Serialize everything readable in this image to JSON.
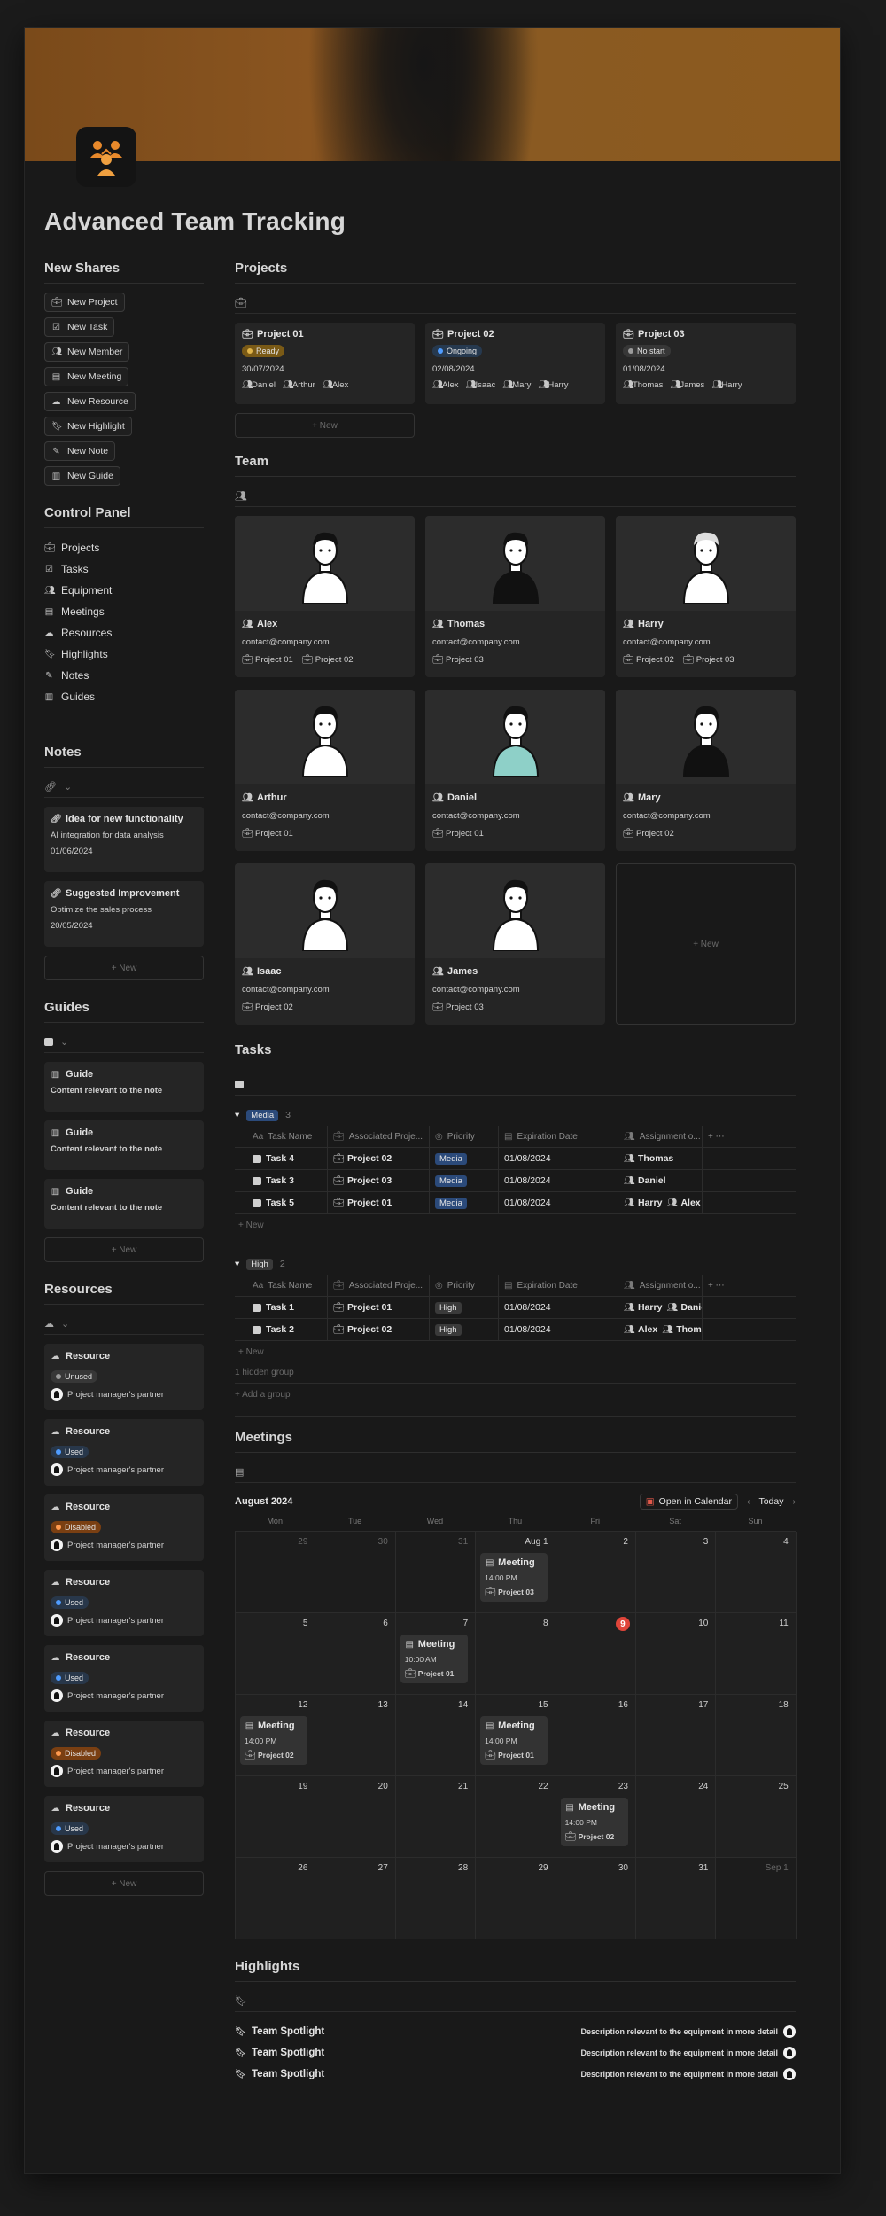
{
  "title": "Advanced Team Tracking",
  "new_shares": {
    "heading": "New Shares",
    "buttons": [
      {
        "label": "New Project",
        "icon": "briefcase-icon"
      },
      {
        "label": "New Task",
        "icon": "checkbox-icon"
      },
      {
        "label": "New Member",
        "icon": "people-icon"
      },
      {
        "label": "New Meeting",
        "icon": "calendar-icon"
      },
      {
        "label": "New Resource",
        "icon": "cloud-icon"
      },
      {
        "label": "New Highlight",
        "icon": "bookmark-icon"
      },
      {
        "label": "New Note",
        "icon": "note-icon"
      },
      {
        "label": "New Guide",
        "icon": "book-icon"
      }
    ]
  },
  "control_panel": {
    "heading": "Control Panel",
    "items": [
      "Projects",
      "Tasks",
      "Equipment",
      "Meetings",
      "Resources",
      "Highlights",
      "Notes",
      "Guides"
    ]
  },
  "notes": {
    "heading": "Notes",
    "cards": [
      {
        "title": "Idea for new functionality",
        "desc": "AI integration for data analysis",
        "date": "01/06/2024"
      },
      {
        "title": "Suggested Improvement",
        "desc": "Optimize the sales process",
        "date": "20/05/2024"
      }
    ],
    "new_label": "+ New"
  },
  "guides": {
    "heading": "Guides",
    "cards": [
      {
        "title": "Guide",
        "desc": "Content relevant to the note"
      },
      {
        "title": "Guide",
        "desc": "Content relevant to the note"
      },
      {
        "title": "Guide",
        "desc": "Content relevant to the note"
      }
    ],
    "new_label": "+ New"
  },
  "resources": {
    "heading": "Resources",
    "cards": [
      {
        "title": "Resource",
        "status": "Unused",
        "status_color": "#9b9b9b",
        "pill_bg": "#373737",
        "owner": "Project manager's partner"
      },
      {
        "title": "Resource",
        "status": "Used",
        "status_color": "#4f9cff",
        "pill_bg": "#28374a",
        "owner": "Project manager's partner"
      },
      {
        "title": "Resource",
        "status": "Disabled",
        "status_color": "#ff9a4f",
        "pill_bg": "#7a3f12",
        "owner": "Project manager's partner"
      },
      {
        "title": "Resource",
        "status": "Used",
        "status_color": "#4f9cff",
        "pill_bg": "#28374a",
        "owner": "Project manager's partner"
      },
      {
        "title": "Resource",
        "status": "Used",
        "status_color": "#4f9cff",
        "pill_bg": "#28374a",
        "owner": "Project manager's partner"
      },
      {
        "title": "Resource",
        "status": "Disabled",
        "status_color": "#ff9a4f",
        "pill_bg": "#7a3f12",
        "owner": "Project manager's partner"
      },
      {
        "title": "Resource",
        "status": "Used",
        "status_color": "#4f9cff",
        "pill_bg": "#28374a",
        "owner": "Project manager's partner"
      }
    ],
    "new_label": "+ New"
  },
  "projects": {
    "heading": "Projects",
    "cards": [
      {
        "title": "Project 01",
        "status": "Ready",
        "status_dot": "#e0b44a",
        "pill_bg": "#7a5a16",
        "date": "30/07/2024",
        "people": [
          "Daniel",
          "Arthur",
          "Alex"
        ]
      },
      {
        "title": "Project 02",
        "status": "Ongoing",
        "status_dot": "#4f9cff",
        "pill_bg": "#26394f",
        "date": "02/08/2024",
        "people": [
          "Alex",
          "Isaac",
          "Mary",
          "Harry"
        ]
      },
      {
        "title": "Project 03",
        "status": "No start",
        "status_dot": "#9b9b9b",
        "pill_bg": "#373737",
        "date": "01/08/2024",
        "people": [
          "Thomas",
          "James",
          "Harry"
        ]
      }
    ],
    "new_label": "+ New"
  },
  "team": {
    "heading": "Team",
    "members": [
      {
        "name": "Alex",
        "email": "contact@company.com",
        "projects": [
          "Project 01",
          "Project 02"
        ]
      },
      {
        "name": "Thomas",
        "email": "contact@company.com",
        "projects": [
          "Project 03"
        ]
      },
      {
        "name": "Harry",
        "email": "contact@company.com",
        "projects": [
          "Project 02",
          "Project 03"
        ]
      },
      {
        "name": "Arthur",
        "email": "contact@company.com",
        "projects": [
          "Project 01"
        ]
      },
      {
        "name": "Daniel",
        "email": "contact@company.com",
        "projects": [
          "Project 01"
        ]
      },
      {
        "name": "Mary",
        "email": "contact@company.com",
        "projects": [
          "Project 02"
        ]
      },
      {
        "name": "Isaac",
        "email": "contact@company.com",
        "projects": [
          "Project 02"
        ]
      },
      {
        "name": "James",
        "email": "contact@company.com",
        "projects": [
          "Project 03"
        ]
      }
    ],
    "new_label": "+ New"
  },
  "tasks": {
    "heading": "Tasks",
    "columns": [
      "Task Name",
      "Associated Proje...",
      "Priority",
      "Expiration Date",
      "Assignment o..."
    ],
    "groups": [
      {
        "label": "Media",
        "count": "3",
        "tag_bg": "#2b4a7a",
        "rows": [
          {
            "name": "Task 4",
            "project": "Project 02",
            "priority": "Media",
            "date": "01/08/2024",
            "people": [
              "Thomas"
            ]
          },
          {
            "name": "Task 3",
            "project": "Project 03",
            "priority": "Media",
            "date": "01/08/2024",
            "people": [
              "Daniel"
            ]
          },
          {
            "name": "Task 5",
            "project": "Project 01",
            "priority": "Media",
            "date": "01/08/2024",
            "people": [
              "Harry",
              "Alex"
            ]
          }
        ]
      },
      {
        "label": "High",
        "count": "2",
        "tag_bg": "#3a3a3a",
        "rows": [
          {
            "name": "Task 1",
            "project": "Project 01",
            "priority": "High",
            "date": "01/08/2024",
            "people": [
              "Harry",
              "Danie"
            ]
          },
          {
            "name": "Task 2",
            "project": "Project 02",
            "priority": "High",
            "date": "01/08/2024",
            "people": [
              "Alex",
              "Thoma"
            ]
          }
        ]
      }
    ],
    "new_label": "+ New",
    "hidden_group": "1 hidden group",
    "add_group": "+ Add a group"
  },
  "meetings": {
    "heading": "Meetings",
    "month": "August 2024",
    "open_calendar": "Open in Calendar",
    "today": "Today",
    "weekdays": [
      "Mon",
      "Tue",
      "Wed",
      "Thu",
      "Fri",
      "Sat",
      "Sun"
    ],
    "days": [
      "29",
      "30",
      "31",
      "Aug 1",
      "2",
      "3",
      "4",
      "5",
      "6",
      "7",
      "8",
      "9",
      "10",
      "11",
      "12",
      "13",
      "14",
      "15",
      "16",
      "17",
      "18",
      "19",
      "20",
      "21",
      "22",
      "23",
      "24",
      "25",
      "26",
      "27",
      "28",
      "29",
      "30",
      "31",
      "Sep 1"
    ],
    "today_index": 11,
    "events": [
      {
        "cell": 3,
        "title": "Meeting",
        "time": "14:00 PM",
        "project": "Project 03"
      },
      {
        "cell": 9,
        "title": "Meeting",
        "time": "10:00 AM",
        "project": "Project 01"
      },
      {
        "cell": 14,
        "title": "Meeting",
        "time": "14:00 PM",
        "project": "Project 02"
      },
      {
        "cell": 17,
        "title": "Meeting",
        "time": "14:00 PM",
        "project": "Project 01"
      },
      {
        "cell": 25,
        "title": "Meeting",
        "time": "14:00 PM",
        "project": "Project 02"
      }
    ]
  },
  "highlights": {
    "heading": "Highlights",
    "rows": [
      {
        "title": "Team Spotlight",
        "desc": "Description relevant to the equipment in more detail"
      },
      {
        "title": "Team Spotlight",
        "desc": "Description relevant to the equipment in more detail"
      },
      {
        "title": "Team Spotlight",
        "desc": "Description relevant to the equipment in more detail"
      }
    ]
  }
}
